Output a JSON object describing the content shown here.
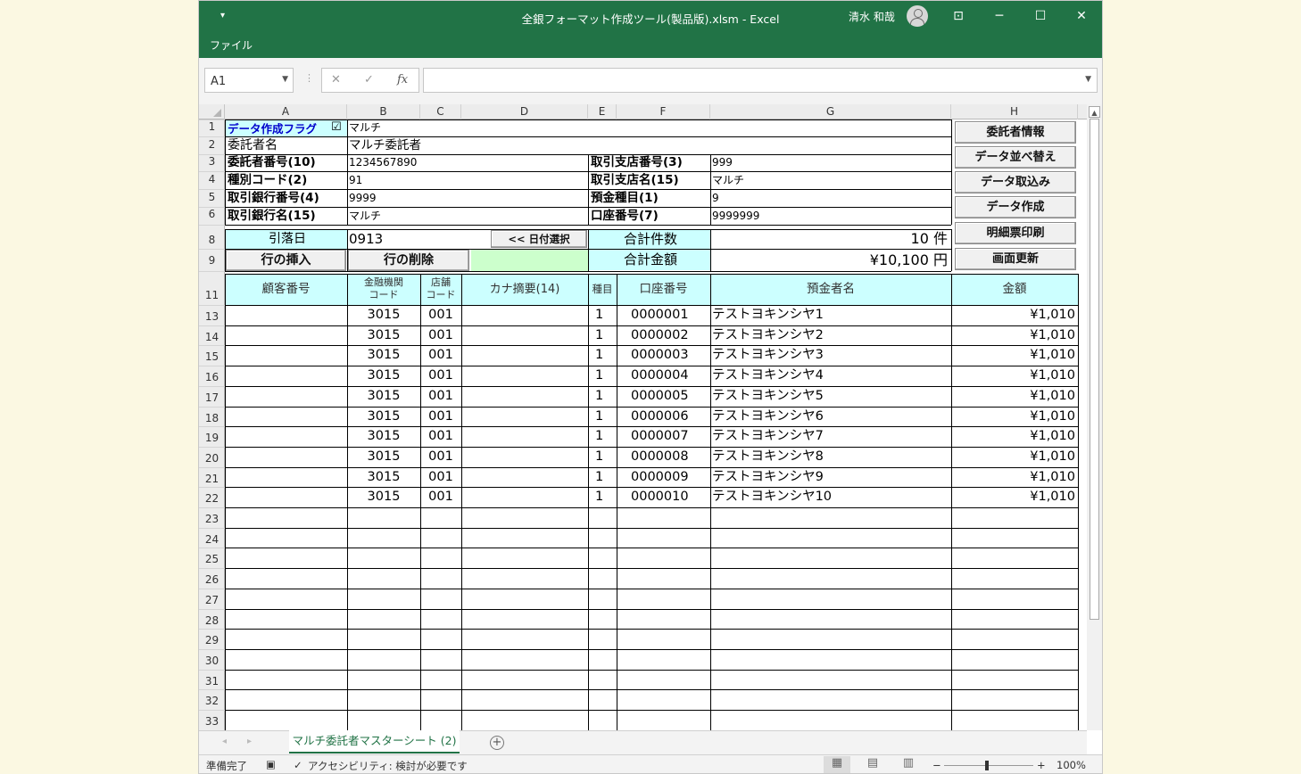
{
  "window": {
    "title": "全銀フォーマット作成ツール(製品版).xlsm  -  Excel",
    "user": "清水 和哉",
    "qa_icon": "▾",
    "controls": {
      "ribbon_display": "⊡",
      "minimize": "─",
      "maximize": "☐",
      "close": "✕"
    }
  },
  "ribbon": {
    "tab": "ファイル"
  },
  "formula_bar": {
    "name_box": "A1",
    "formula": "",
    "icons": {
      "cancel": "✕",
      "enter": "✓",
      "fx": "fx"
    }
  },
  "columns": [
    "A",
    "B",
    "C",
    "D",
    "E",
    "F",
    "G",
    "H"
  ],
  "header_section": {
    "flag_label": "データ作成フラグ",
    "flag_checked": true,
    "flag_check": "☑",
    "flag_value": "マルチ",
    "rows": [
      {
        "label": "委託者名",
        "value": "マルチ委託者"
      },
      {
        "label": "委託者番号(10)",
        "value": "1234567890",
        "label2": "取引支店番号(3)",
        "value2": "999"
      },
      {
        "label": "種別コード(2)",
        "value": "91",
        "label2": "取引支店名(15)",
        "value2": "マルチ"
      },
      {
        "label": "取引銀行番号(4)",
        "value": "9999",
        "label2": "預金種目(1)",
        "value2": "9"
      },
      {
        "label": "取引銀行名(15)",
        "value": "マルチ",
        "label2": "口座番号(7)",
        "value2": "9999999"
      }
    ],
    "debit_date_label": "引落日",
    "debit_date": "0913",
    "date_select_button": "<< 日付選択",
    "total_count_label": "合計件数",
    "total_count": "10 件",
    "total_amount_label": "合計金額",
    "total_amount": "¥10,100 円",
    "insert_row_button": "行の挿入",
    "delete_row_button": "行の削除"
  },
  "side_buttons": [
    "委託者情報",
    "データ並べ替え",
    "データ取込み",
    "データ作成",
    "明細票印刷",
    "画面更新"
  ],
  "table": {
    "headers": {
      "customer_no": "顧客番号",
      "bank_code_1": "金融機関",
      "bank_code_2": "コード",
      "branch_code_1": "店舗",
      "branch_code_2": "コード",
      "kana_summary": "カナ摘要(14)",
      "type": "種目",
      "account_no": "口座番号",
      "holder": "預金者名",
      "amount": "金額"
    },
    "rows": [
      {
        "row": "13",
        "customer": "",
        "bank": "3015",
        "branch": "001",
        "kana": "",
        "type": "1",
        "account": "0000001",
        "holder": "テストヨキンシヤ1",
        "amount": "¥1,010"
      },
      {
        "row": "14",
        "customer": "",
        "bank": "3015",
        "branch": "001",
        "kana": "",
        "type": "1",
        "account": "0000002",
        "holder": "テストヨキンシヤ2",
        "amount": "¥1,010"
      },
      {
        "row": "15",
        "customer": "",
        "bank": "3015",
        "branch": "001",
        "kana": "",
        "type": "1",
        "account": "0000003",
        "holder": "テストヨキンシヤ3",
        "amount": "¥1,010"
      },
      {
        "row": "16",
        "customer": "",
        "bank": "3015",
        "branch": "001",
        "kana": "",
        "type": "1",
        "account": "0000004",
        "holder": "テストヨキンシヤ4",
        "amount": "¥1,010"
      },
      {
        "row": "17",
        "customer": "",
        "bank": "3015",
        "branch": "001",
        "kana": "",
        "type": "1",
        "account": "0000005",
        "holder": "テストヨキンシヤ5",
        "amount": "¥1,010"
      },
      {
        "row": "18",
        "customer": "",
        "bank": "3015",
        "branch": "001",
        "kana": "",
        "type": "1",
        "account": "0000006",
        "holder": "テストヨキンシヤ6",
        "amount": "¥1,010"
      },
      {
        "row": "19",
        "customer": "",
        "bank": "3015",
        "branch": "001",
        "kana": "",
        "type": "1",
        "account": "0000007",
        "holder": "テストヨキンシヤ7",
        "amount": "¥1,010"
      },
      {
        "row": "20",
        "customer": "",
        "bank": "3015",
        "branch": "001",
        "kana": "",
        "type": "1",
        "account": "0000008",
        "holder": "テストヨキンシヤ8",
        "amount": "¥1,010"
      },
      {
        "row": "21",
        "customer": "",
        "bank": "3015",
        "branch": "001",
        "kana": "",
        "type": "1",
        "account": "0000009",
        "holder": "テストヨキンシヤ9",
        "amount": "¥1,010"
      },
      {
        "row": "22",
        "customer": "",
        "bank": "3015",
        "branch": "001",
        "kana": "",
        "type": "1",
        "account": "0000010",
        "holder": "テストヨキンシヤ10",
        "amount": "¥1,010"
      },
      {
        "row": "23",
        "customer": "",
        "bank": "",
        "branch": "",
        "kana": "",
        "type": "",
        "account": "",
        "holder": "",
        "amount": ""
      },
      {
        "row": "24",
        "customer": "",
        "bank": "",
        "branch": "",
        "kana": "",
        "type": "",
        "account": "",
        "holder": "",
        "amount": ""
      },
      {
        "row": "25",
        "customer": "",
        "bank": "",
        "branch": "",
        "kana": "",
        "type": "",
        "account": "",
        "holder": "",
        "amount": ""
      },
      {
        "row": "26",
        "customer": "",
        "bank": "",
        "branch": "",
        "kana": "",
        "type": "",
        "account": "",
        "holder": "",
        "amount": ""
      },
      {
        "row": "27",
        "customer": "",
        "bank": "",
        "branch": "",
        "kana": "",
        "type": "",
        "account": "",
        "holder": "",
        "amount": ""
      },
      {
        "row": "28",
        "customer": "",
        "bank": "",
        "branch": "",
        "kana": "",
        "type": "",
        "account": "",
        "holder": "",
        "amount": ""
      },
      {
        "row": "29",
        "customer": "",
        "bank": "",
        "branch": "",
        "kana": "",
        "type": "",
        "account": "",
        "holder": "",
        "amount": ""
      },
      {
        "row": "30",
        "customer": "",
        "bank": "",
        "branch": "",
        "kana": "",
        "type": "",
        "account": "",
        "holder": "",
        "amount": ""
      },
      {
        "row": "31",
        "customer": "",
        "bank": "",
        "branch": "",
        "kana": "",
        "type": "",
        "account": "",
        "holder": "",
        "amount": ""
      },
      {
        "row": "32",
        "customer": "",
        "bank": "",
        "branch": "",
        "kana": "",
        "type": "",
        "account": "",
        "holder": "",
        "amount": ""
      },
      {
        "row": "33",
        "customer": "",
        "bank": "",
        "branch": "",
        "kana": "",
        "type": "",
        "account": "",
        "holder": "",
        "amount": ""
      }
    ]
  },
  "top_row_numbers": [
    "1",
    "2",
    "3",
    "4",
    "5",
    "6",
    "8",
    "9",
    "11"
  ],
  "sheet_tabs": {
    "active": "マルチ委託者マスターシート (2)",
    "add": "+",
    "prev": "◂",
    "next": "▸"
  },
  "status_bar": {
    "ready": "準備完了",
    "accessibility": "アクセシビリティ: 検討が必要です",
    "zoom": "100%",
    "minus": "−",
    "plus": "+",
    "view_normal": "▦",
    "view_page_layout": "▤",
    "view_page_break": "▥",
    "macro_icon": "▣",
    "a11y_icon": "✓"
  },
  "colors": {
    "excel_green": "#217346",
    "label_fill": "#ccffff",
    "pale_green": "#ccffcc"
  }
}
